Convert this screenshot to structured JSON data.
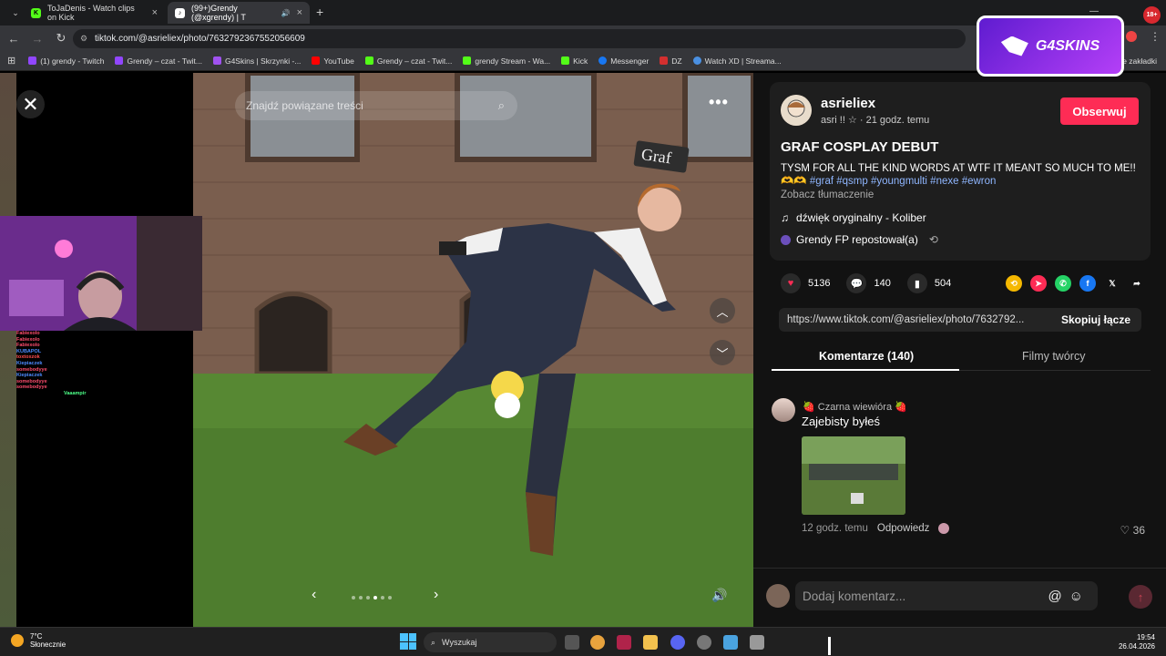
{
  "browser": {
    "tabs": [
      {
        "title": "ToJaDenis - Watch clips on Kick",
        "color": "#53fc18",
        "letter": "K"
      },
      {
        "title": "(99+)Grendy (@xgrendy) | T",
        "color": "#ffffff",
        "letter": "♪"
      }
    ],
    "new_tab": "+",
    "url": "tiktok.com/@asrieliex/photo/7632792367552056609",
    "bookmarks": [
      {
        "label": "(1) grendy - Twitch",
        "color": "#9146ff"
      },
      {
        "label": "Grendy – czat - Twit...",
        "color": "#9146ff"
      },
      {
        "label": "G4Skins | Skrzynki -...",
        "color": "#a052f0"
      },
      {
        "label": "YouTube",
        "color": "#ff0000"
      },
      {
        "label": "Grendy – czat - Twit...",
        "color": "#53fc18"
      },
      {
        "label": "grendy Stream - Wa...",
        "color": "#53fc18"
      },
      {
        "label": "Kick",
        "color": "#53fc18"
      },
      {
        "label": "Messenger",
        "color": "#1877f2"
      },
      {
        "label": "DZ",
        "color": "#d32f2f"
      },
      {
        "label": "Watch XD | Streama...",
        "color": "#4a90e2"
      }
    ],
    "all_bookmarks": "e zakładki"
  },
  "overlay": {
    "g4skins_label": "G4SKINS",
    "age_badge": "18+"
  },
  "stream_chat": [
    {
      "name": "Fabiexolo",
      "color": "#ff4d6d"
    },
    {
      "name": "Fabiexolo",
      "color": "#ff4d6d"
    },
    {
      "name": "Fabiexolo",
      "color": "#ff4d6d"
    },
    {
      "name": "KUBAPOL",
      "color": "#4d8bff"
    },
    {
      "name": "toxtoxzok",
      "color": "#ff4d4d"
    },
    {
      "name": "Kiepiaczek",
      "color": "#4d8bff"
    },
    {
      "name": "somebodyye",
      "color": "#ff4d6d"
    },
    {
      "name": "Kiepiaczek",
      "color": "#4d8bff"
    },
    {
      "name": "somebodyye",
      "color": "#ff4d6d"
    },
    {
      "name": "somebodyye",
      "color": "#ff4d6d"
    },
    {
      "name": "Vaaampir",
      "color": "#4dff88"
    }
  ],
  "viewer": {
    "search_placeholder": "Znajdź powiązane treści",
    "sign": "Graf"
  },
  "post": {
    "username": "asrieliex",
    "subtitle": "asri !! ☆ · 21 godz. temu",
    "follow": "Obserwuj",
    "title": "GRAF COSPLAY DEBUT",
    "desc": "TYSM FOR ALL THE KIND WORDS AT WTF IT MEANT SO MUCH TO ME!!",
    "emoji": "🫶🫶",
    "hashtags": "#graf #qsmp #youngmulti #nexe #ewron",
    "translate": "Zobacz tłumaczenie",
    "sound": "dźwięk oryginalny - Koliber",
    "repost": "Grendy FP repostował(a)",
    "likes": "5136",
    "comments": "140",
    "saves": "504",
    "link": "https://www.tiktok.com/@asrieliex/photo/7632792...",
    "copy": "Skopiuj łącze",
    "tab_comments": "Komentarze (140)",
    "tab_creator": "Filmy twórcy"
  },
  "comment": {
    "author": "Czarna wiewióra",
    "text": "Zajebisty byłeś",
    "time": "12 godz. temu",
    "reply": "Odpowiedz",
    "likes": "36"
  },
  "composer": {
    "placeholder": "Dodaj komentarz..."
  },
  "taskbar": {
    "temp": "7°C",
    "weather": "Słonecznie",
    "search": "Wyszukaj",
    "time": "19:54",
    "date": "26.04.2026"
  }
}
